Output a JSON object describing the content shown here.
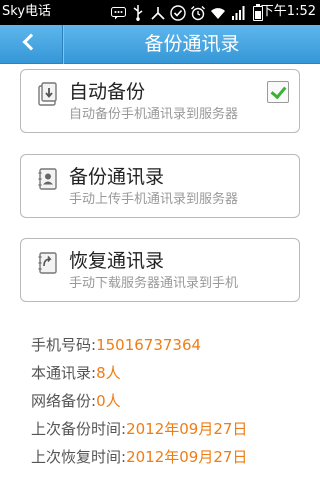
{
  "status_bar": {
    "carrier": "Sky电话",
    "time": "下午1:52",
    "icons": [
      "message-icon",
      "usb-icon",
      "share-icon",
      "check-circle-icon",
      "alarm-icon",
      "wifi-icon",
      "signal-icon",
      "battery-icon"
    ]
  },
  "title_bar": {
    "title": "备份通讯录",
    "back_icon": "chevron-left-icon"
  },
  "options": [
    {
      "title": "自动备份",
      "subtitle": "自动备份手机通讯录到服务器",
      "icon": "backup-doc-icon",
      "checked": true
    },
    {
      "title": "备份通讯录",
      "subtitle": "手动上传手机通讯录到服务器",
      "icon": "contacts-book-icon"
    },
    {
      "title": "恢复通讯录",
      "subtitle": "手动下载服务器通讯录到手机",
      "icon": "restore-doc-icon"
    }
  ],
  "info": [
    {
      "label": "手机号码:",
      "value": "15016737364"
    },
    {
      "label": "本通讯录:",
      "value": "8人"
    },
    {
      "label": "网络备份:",
      "value": "0人"
    },
    {
      "label": "上次备份时间:",
      "value": "2012年09月27日"
    },
    {
      "label": "上次恢复时间:",
      "value": "2012年09月27日"
    }
  ],
  "colors": {
    "title_bar": "#3ea2e0",
    "value_text": "#ef7d14",
    "check": "#3cb134"
  }
}
